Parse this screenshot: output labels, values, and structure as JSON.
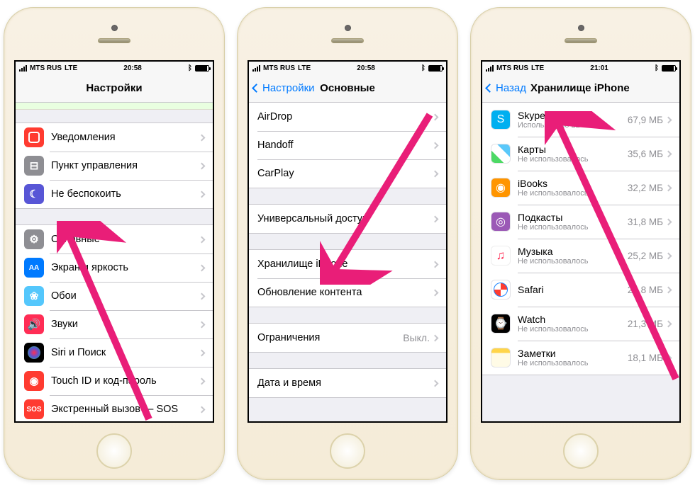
{
  "status": {
    "carrier": "MTS RUS",
    "network": "LTE",
    "time_a": "20:58",
    "time_b": "20:58",
    "time_c": "21:01"
  },
  "screen1": {
    "title": "Настройки",
    "group1": [
      {
        "label": "Уведомления"
      },
      {
        "label": "Пункт управления"
      },
      {
        "label": "Не беспокоить"
      }
    ],
    "group2": [
      {
        "label": "Основные"
      },
      {
        "label": "Экран и яркость"
      },
      {
        "label": "Обои"
      },
      {
        "label": "Звуки"
      },
      {
        "label": "Siri и Поиск"
      },
      {
        "label": "Touch ID и код-пароль"
      },
      {
        "label": "Экстренный вызов — SOS"
      }
    ]
  },
  "screen2": {
    "back": "Настройки",
    "title": "Основные",
    "group1": [
      {
        "label": "AirDrop"
      },
      {
        "label": "Handoff"
      },
      {
        "label": "CarPlay"
      }
    ],
    "group2": [
      {
        "label": "Универсальный доступ"
      }
    ],
    "group3": [
      {
        "label": "Хранилище iPhone"
      },
      {
        "label": "Обновление контента"
      }
    ],
    "group4": [
      {
        "label": "Ограничения",
        "detail": "Выкл."
      }
    ],
    "group5": [
      {
        "label": "Дата и время"
      }
    ]
  },
  "screen3": {
    "back": "Назад",
    "title": "Хранилище iPhone",
    "apps": [
      {
        "name": "Skype",
        "sub": "Использовано 22 сент...",
        "size": "67,9 МБ"
      },
      {
        "name": "Карты",
        "sub": "Не использовалось",
        "size": "35,6 МБ"
      },
      {
        "name": "iBooks",
        "sub": "Не использовалось",
        "size": "32,2 МБ"
      },
      {
        "name": "Подкасты",
        "sub": "Не использовалось",
        "size": "31,8 МБ"
      },
      {
        "name": "Музыка",
        "sub": "Не использовалось",
        "size": "25,2 МБ"
      },
      {
        "name": "Safari",
        "sub": "",
        "size": "24,8 МБ"
      },
      {
        "name": "Watch",
        "sub": "Не использовалось",
        "size": "21,3 МБ"
      },
      {
        "name": "Заметки",
        "sub": "Не использовалось",
        "size": "18,1 МБ"
      }
    ]
  },
  "sos_text": "SOS"
}
